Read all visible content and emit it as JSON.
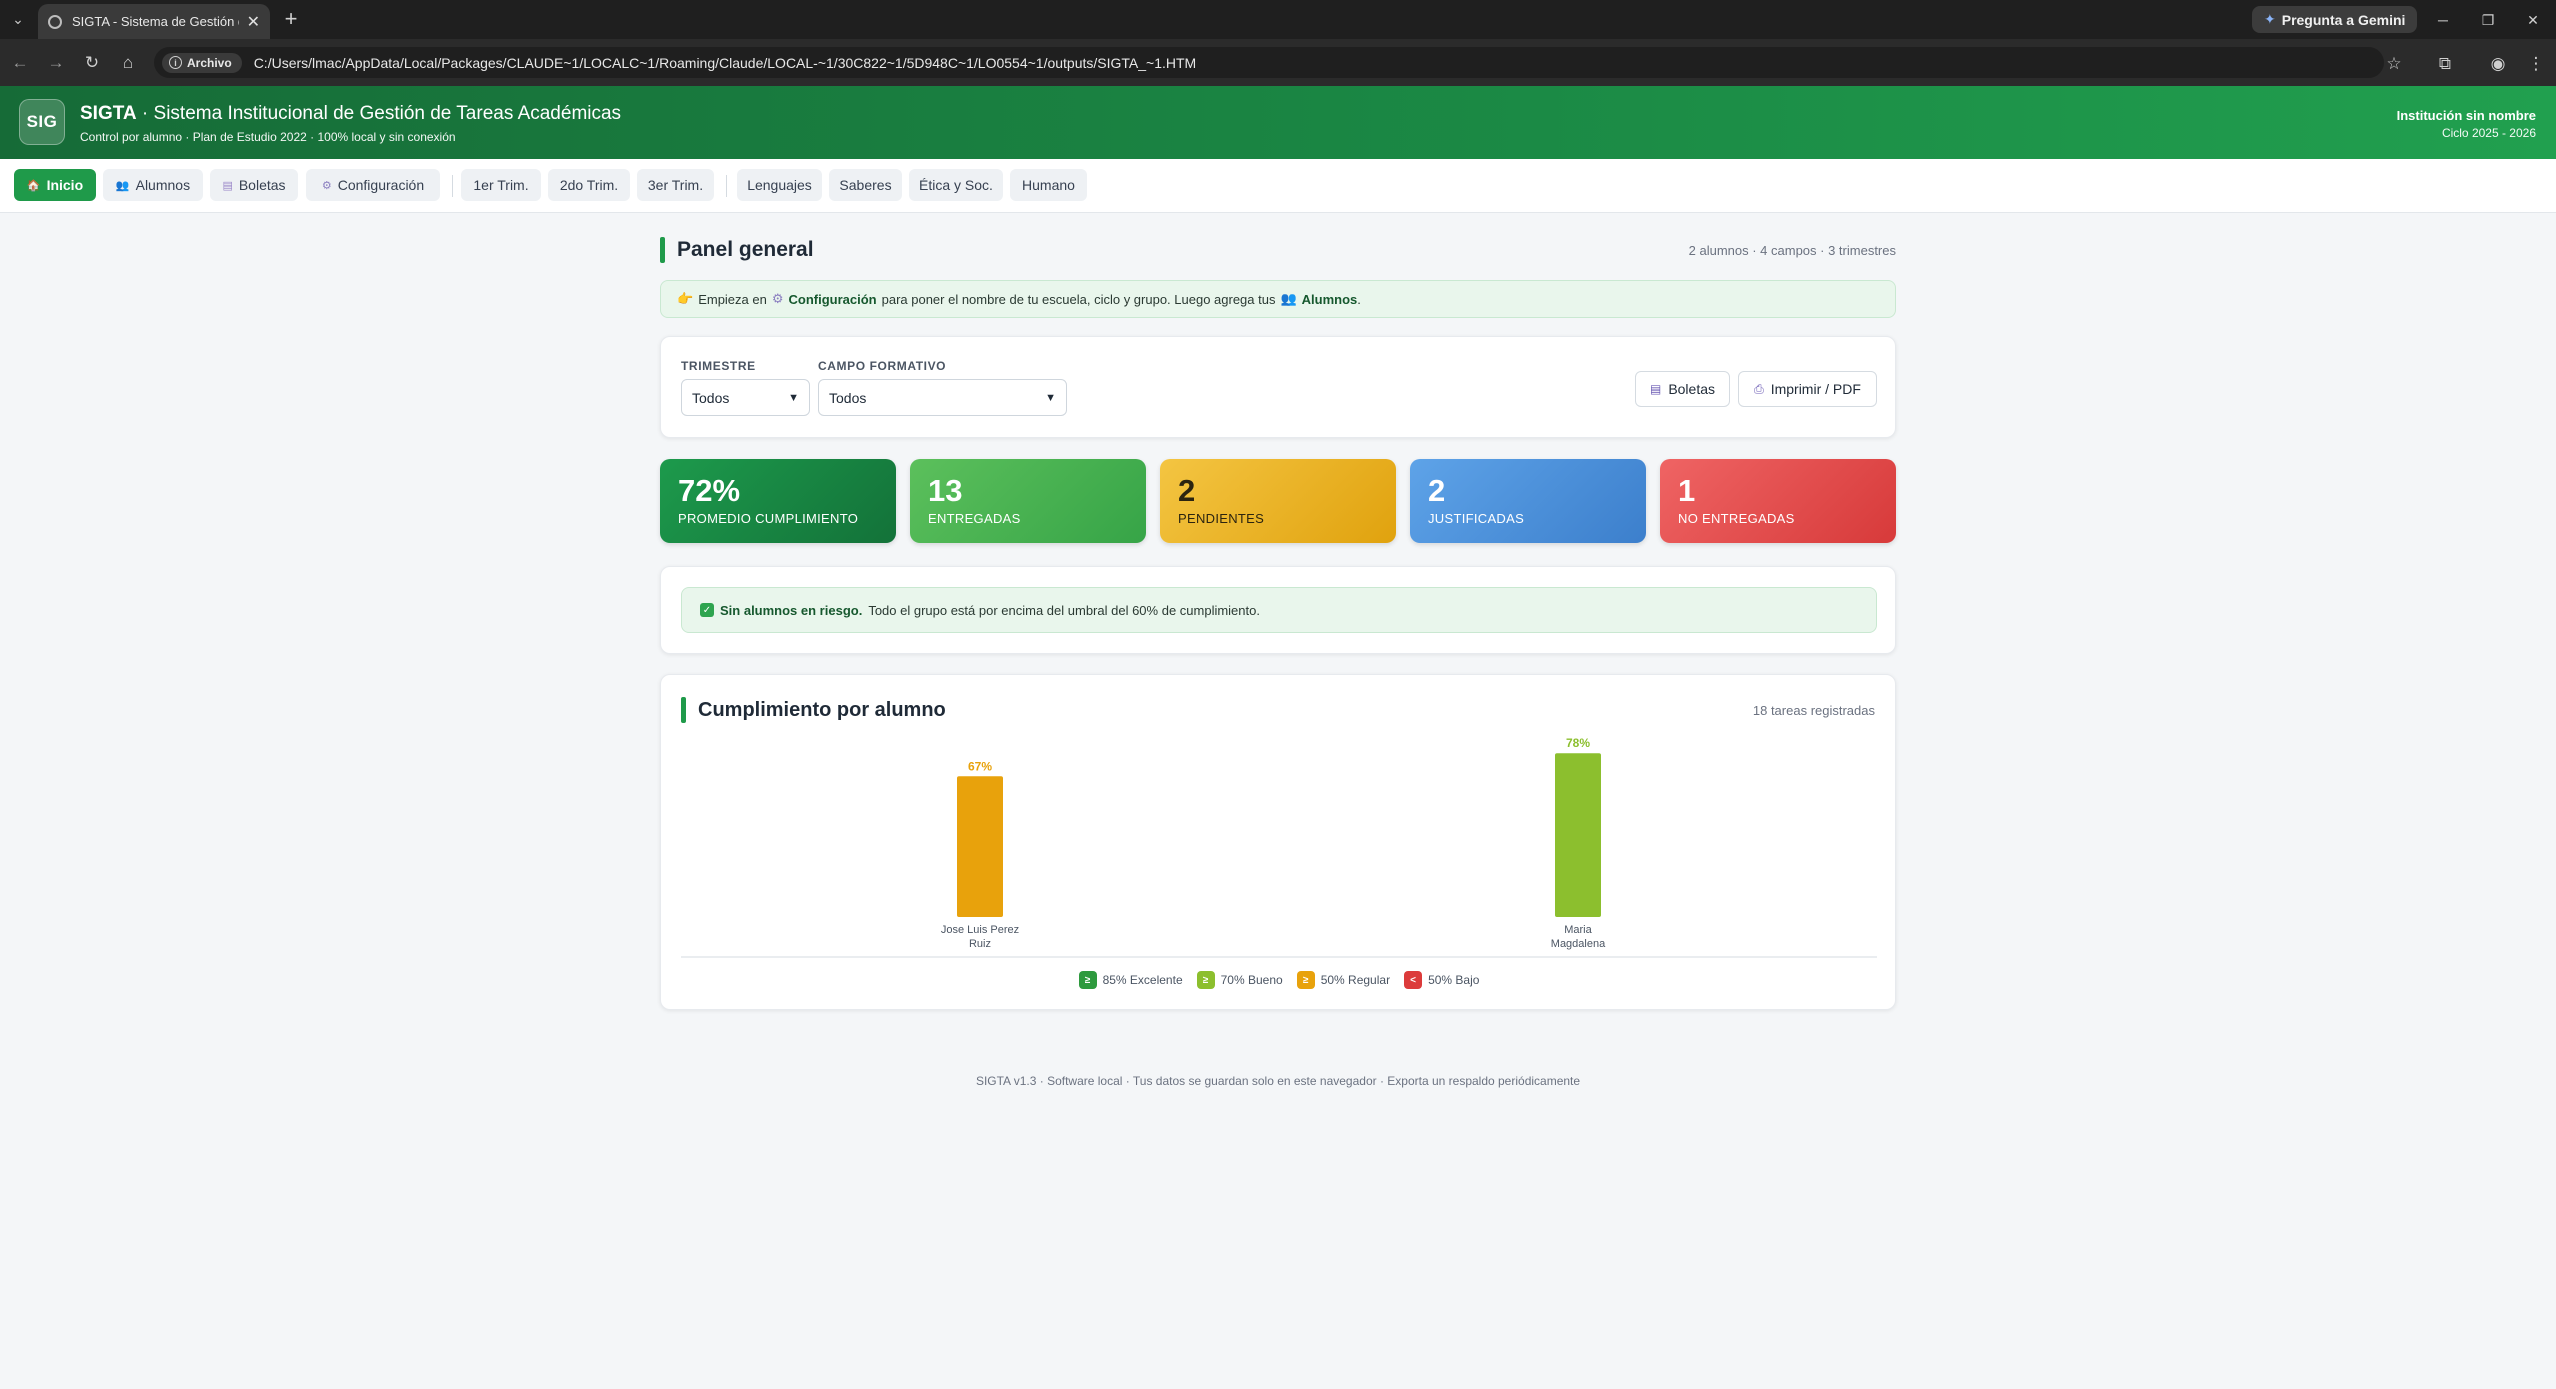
{
  "browser": {
    "tab_title": "SIGTA - Sistema de Gestión de T",
    "gemini_label": "Pregunta a Gemini",
    "site_chip": "Archivo",
    "url": "C:/Users/lmac/AppData/Local/Packages/CLAUDE~1/LOCALC~1/Roaming/Claude/LOCAL-~1/30C822~1/5D948C~1/LO0554~1/outputs/SIGTA_~1.HTM"
  },
  "header": {
    "logo": "SIG",
    "title_brand": "SIGTA",
    "title_rest": " · Sistema Institucional de Gestión de Tareas Académicas",
    "subtitle": "Control por alumno · Plan de Estudio 2022 · 100% local y sin conexión",
    "institution": "Institución sin nombre",
    "cycle": "Ciclo 2025 - 2026"
  },
  "nav": {
    "inicio": "Inicio",
    "alumnos": "Alumnos",
    "boletas": "Boletas",
    "configuracion": "Configuración",
    "trim1": "1er Trim.",
    "trim2": "2do Trim.",
    "trim3": "3er Trim.",
    "lenguajes": "Lenguajes",
    "saberes": "Saberes",
    "etica": "Ética y Soc.",
    "humano": "Humano"
  },
  "panel": {
    "title": "Panel general",
    "meta": "2 alumnos · 4 campos · 3 trimestres"
  },
  "hint": {
    "start": "Empieza en",
    "config": "Configuración",
    "middle": "para poner el nombre de tu escuela, ciclo y grupo. Luego agrega tus",
    "alumnos": "Alumnos",
    "end": "."
  },
  "filters": {
    "trimestre_label": "TRIMESTRE",
    "trimestre_value": "Todos",
    "campo_label": "CAMPO FORMATIVO",
    "campo_value": "Todos",
    "boletas_btn": "Boletas",
    "print_btn": "Imprimir / PDF"
  },
  "stats": [
    {
      "value": "72%",
      "label": "PROMEDIO CUMPLIMIENTO"
    },
    {
      "value": "13",
      "label": "ENTREGADAS"
    },
    {
      "value": "2",
      "label": "PENDIENTES"
    },
    {
      "value": "2",
      "label": "JUSTIFICADAS"
    },
    {
      "value": "1",
      "label": "NO ENTREGADAS"
    }
  ],
  "risk": {
    "bold": "Sin alumnos en riesgo.",
    "text": "Todo el grupo está por encima del umbral del 60% de cumplimiento."
  },
  "chart_section": {
    "title": "Cumplimiento por alumno",
    "meta": "18 tareas registradas"
  },
  "chart_data": {
    "type": "bar",
    "categories": [
      "Jose Luis Perez Ruiz",
      "Maria Magdalena"
    ],
    "category_lines": [
      [
        "Jose Luis Perez",
        "Ruiz"
      ],
      [
        "Maria",
        "Magdalena"
      ]
    ],
    "values": [
      67,
      78
    ],
    "value_labels": [
      "67%",
      "78%"
    ],
    "bar_colors": [
      "#e8a20c",
      "#8cbf2e"
    ],
    "ylim": [
      0,
      100
    ],
    "legend": [
      {
        "symbol": "≥",
        "label": "85% Excelente",
        "color": "#2e9a3e"
      },
      {
        "symbol": "≥",
        "label": "70% Bueno",
        "color": "#8cbf2e"
      },
      {
        "symbol": "≥",
        "label": "50% Regular",
        "color": "#e8a20c"
      },
      {
        "symbol": "<",
        "label": "50% Bajo",
        "color": "#dc3b3b"
      }
    ]
  },
  "footer": "SIGTA v1.3 · Software local · Tus datos se guardan solo en este navegador · Exporta un respaldo periódicamente"
}
